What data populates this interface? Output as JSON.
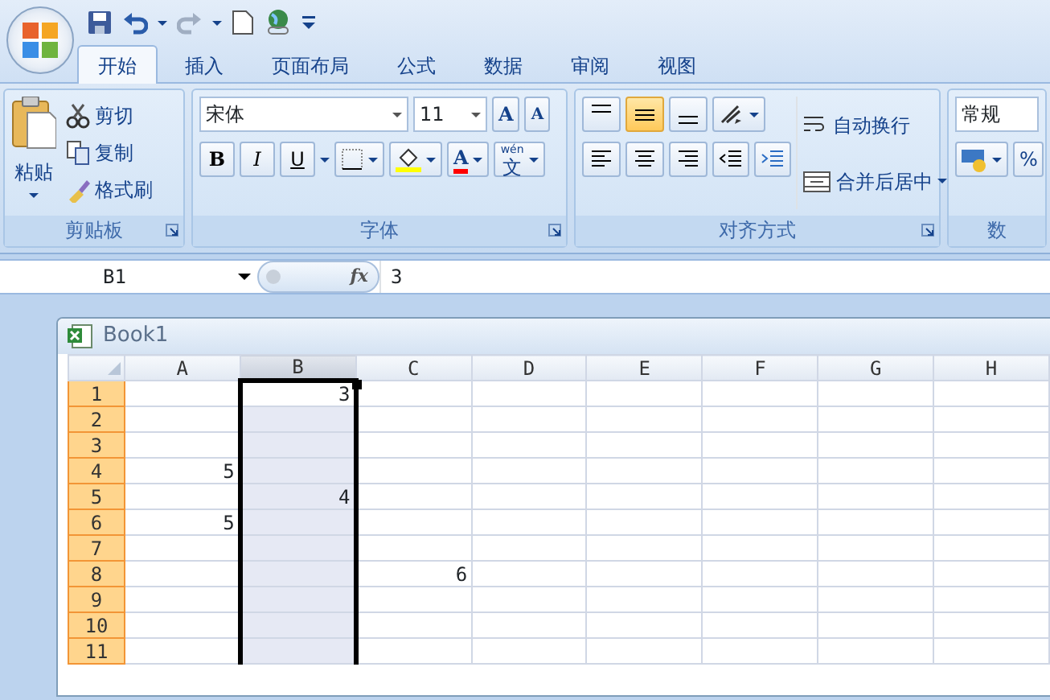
{
  "tabs": [
    {
      "label": "开始",
      "selected": true
    },
    {
      "label": "插入",
      "selected": false
    },
    {
      "label": "页面布局",
      "selected": false
    },
    {
      "label": "公式",
      "selected": false
    },
    {
      "label": "数据",
      "selected": false
    },
    {
      "label": "审阅",
      "selected": false
    },
    {
      "label": "视图",
      "selected": false
    }
  ],
  "clipboard": {
    "paste": "粘贴",
    "items": [
      "剪切",
      "复制",
      "格式刷"
    ],
    "title": "剪贴板"
  },
  "font": {
    "name": "宋体",
    "size": "11",
    "grow": "A",
    "shrink": "A",
    "bold": "B",
    "italic": "I",
    "underline": "U",
    "font_color": "A",
    "phonetic_reading": "wén",
    "phonetic_base": "文",
    "title": "字体"
  },
  "alignment": {
    "vertical": [
      {
        "selected": false
      },
      {
        "selected": true
      },
      {
        "selected": false
      }
    ],
    "wrap_text": "自动换行",
    "merge_center": "合并后居中",
    "title": "对齐方式"
  },
  "number": {
    "format": "常规",
    "percent": "%",
    "title": "数"
  },
  "formula_bar": {
    "name_box": "B1",
    "fx": "fx",
    "value": "3"
  },
  "workbook": {
    "title": "Book1",
    "columns": [
      {
        "label": "A",
        "selected": false
      },
      {
        "label": "B",
        "selected": true
      },
      {
        "label": "C",
        "selected": false
      },
      {
        "label": "D",
        "selected": false
      },
      {
        "label": "E",
        "selected": false
      },
      {
        "label": "F",
        "selected": false
      },
      {
        "label": "G",
        "selected": false
      },
      {
        "label": "H",
        "selected": false
      }
    ],
    "rows": [
      {
        "label": "1",
        "selected": true,
        "cells": {
          "B": "3"
        }
      },
      {
        "label": "2",
        "selected": true
      },
      {
        "label": "3",
        "selected": true
      },
      {
        "label": "4",
        "selected": true,
        "cells": {
          "A": "5"
        }
      },
      {
        "label": "5",
        "selected": true,
        "cells": {
          "B": "4"
        }
      },
      {
        "label": "6",
        "selected": true,
        "cells": {
          "A": "5"
        }
      },
      {
        "label": "7",
        "selected": true
      },
      {
        "label": "8",
        "selected": true,
        "cells": {
          "C": "6"
        }
      },
      {
        "label": "9",
        "selected": true
      },
      {
        "label": "10",
        "selected": true
      },
      {
        "label": "11",
        "selected": true
      }
    ]
  }
}
